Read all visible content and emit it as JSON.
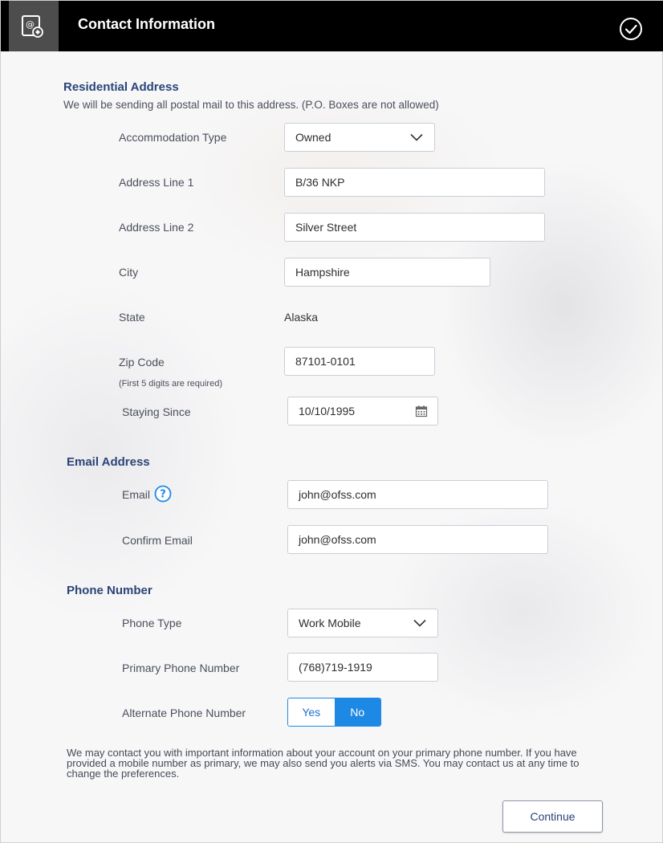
{
  "header": {
    "title": "Contact Information",
    "icon": "contact-card-icon",
    "status_icon": "check-circle-icon"
  },
  "residential": {
    "title": "Residential Address",
    "description": "We will be sending all postal mail to this address. (P.O. Boxes are not allowed)",
    "accommodation_label": "Accommodation Type",
    "accommodation_value": "Owned",
    "address1_label": "Address Line 1",
    "address1_value": "B/36 NKP",
    "address2_label": "Address Line 2",
    "address2_value": "Silver Street",
    "city_label": "City",
    "city_value": "Hampshire",
    "state_label": "State",
    "state_value": "Alaska",
    "zip_label": "Zip Code",
    "zip_hint": "(First 5 digits are required)",
    "zip_value": "87101-0101",
    "since_label": "Staying Since",
    "since_value": "10/10/1995"
  },
  "email": {
    "title": "Email Address",
    "email_label": "Email",
    "email_value": "john@ofss.com",
    "confirm_label": "Confirm Email",
    "confirm_value": "john@ofss.com"
  },
  "phone": {
    "title": "Phone Number",
    "type_label": "Phone Type",
    "type_value": "Work Mobile",
    "primary_label": "Primary Phone Number",
    "primary_value": "(768)719-1919",
    "alternate_label": "Alternate Phone Number",
    "alternate_yes": "Yes",
    "alternate_no": "No",
    "alternate_selected": "No"
  },
  "notice": "We may contact you with important information about your account on your primary phone number. If you have provided a mobile number as primary, we may also send you alerts via SMS. You may contact us at any time to change the preferences.",
  "continue_label": "Continue",
  "colors": {
    "accent": "#1e88e5",
    "heading": "#2b4478",
    "header_bg": "#000000"
  }
}
